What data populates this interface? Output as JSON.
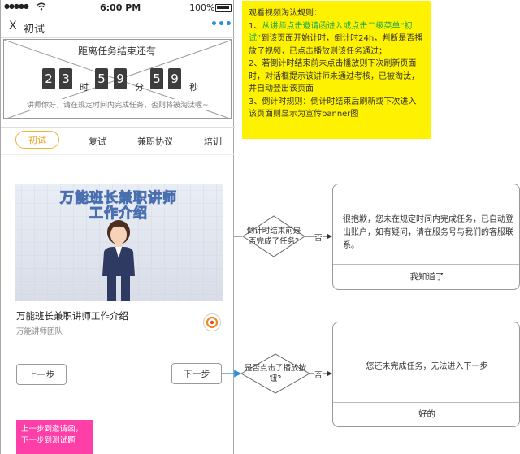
{
  "status_bar": {
    "signal": "●●●●●",
    "wifi_icon": "wifi-icon",
    "time": "6:00 PM",
    "battery": "100%"
  },
  "navbar": {
    "close": "X",
    "title": "初试",
    "more": "•••"
  },
  "countdown": {
    "title": "距离任务结束还有",
    "hours": [
      "2",
      "3"
    ],
    "hour_unit": "时",
    "minutes": [
      "5",
      "9"
    ],
    "minute_unit": "分",
    "seconds": [
      "5",
      "9"
    ],
    "second_unit": "秒",
    "hint": "讲师你好，请在规定时间内完成任务，否则将被淘汰喔~"
  },
  "tabs": [
    "初试",
    "复试",
    "兼职协议",
    "培训"
  ],
  "video": {
    "banner_line1": "万能班长兼职讲师",
    "banner_line2": "工作介绍",
    "title": "万能班长兼职讲师工作介绍",
    "author": "万能讲师团队"
  },
  "buttons": {
    "prev": "上一步",
    "next": "下一步"
  },
  "rules_note": {
    "heading": "观看视频淘汰规则：",
    "item1_prefix": "1、",
    "item1_green": "从讲师点击邀请函进入或点击二级菜单“初试”",
    "item1_rest": "到该页面开始计时，倒计时24h，判断是否播放了视频，已点击播放则该任务通过；",
    "item2": "2、若倒计时结束前未点击播放则下次刷新页面时，对话框提示该讲师未通过考核，已被淘汰，并自动登出该页面",
    "item3": "3、倒计时规则：倒计时结束后刷新或下次进入该页面则显示为宣传banner图"
  },
  "flow1": {
    "decision": "倒计时结束前是否完成了任务?",
    "no_label": "否"
  },
  "flow2": {
    "decision": "是否点击了播放按钮?",
    "no_label": "否"
  },
  "dialog1": {
    "message": "很抱歉，您未在规定时间内完成任务，已自动登出账户，如有疑问，请在服务号与我们的客服联系。",
    "button": "我知道了"
  },
  "dialog2": {
    "message": "您还未完成任务，无法进入下一步",
    "button": "好的"
  },
  "pink_note": {
    "text": "上一步到邀请函，下一步到测试题"
  },
  "colors": {
    "accent": "#f0a020",
    "note_yellow": "#fff200",
    "note_pink": "#ff3fa8",
    "link_blue": "#2a8fd6",
    "green": "#1aa94a"
  }
}
